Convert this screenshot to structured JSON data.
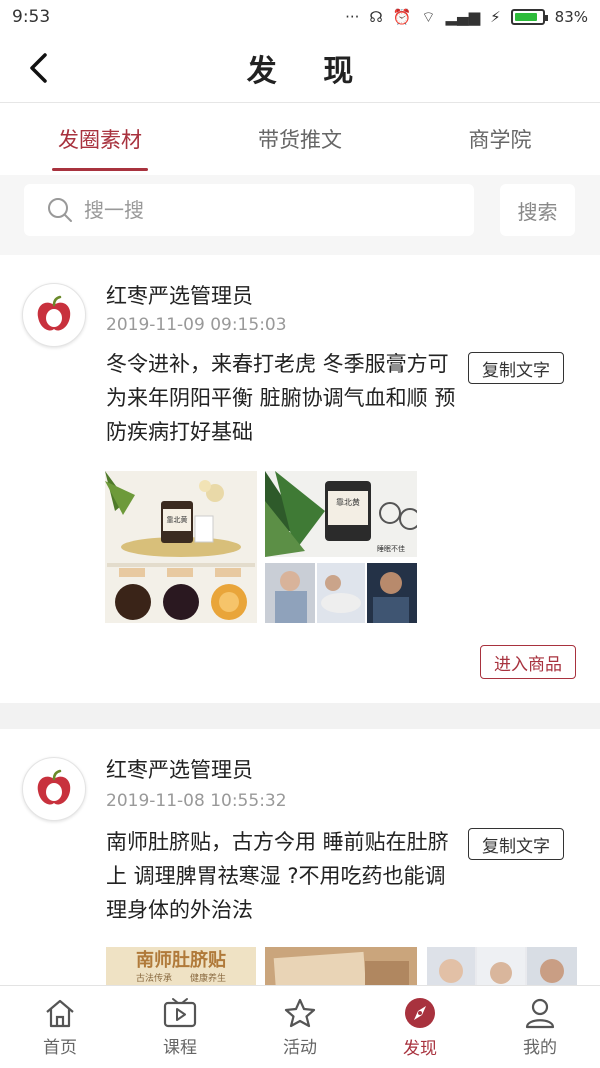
{
  "status": {
    "time": "9:53",
    "battery": "83%",
    "battery_level": 0.83
  },
  "header": {
    "title": "发 现"
  },
  "tabs": [
    {
      "label": "发圈素材",
      "active": true
    },
    {
      "label": "带货推文",
      "active": false
    },
    {
      "label": "商学院",
      "active": false
    }
  ],
  "search": {
    "placeholder": "搜一搜",
    "button": "搜索"
  },
  "posts": [
    {
      "author": "红枣严选管理员",
      "time": "2019-11-09 09:15:03",
      "text": "冬令进补，来春打老虎 冬季服膏方可为来年阴阳平衡 脏腑协调气血和顺 预防疾病打好基础",
      "copy_label": "复制文字",
      "enter_label": "进入商品",
      "image_text": {
        "label1": "靠北黄",
        "label2": "靠北黄",
        "caption": "睡眠不佳"
      }
    },
    {
      "author": "红枣严选管理员",
      "time": "2019-11-08 10:55:32",
      "text": "南师肚脐贴，古方今用 睡前贴在肚脐上 调理脾胃祛寒湿 ?不用吃药也能调理身体的外治法",
      "copy_label": "复制文字",
      "image_text": {
        "banner": "南师肚脐贴",
        "sub1": "古法传承",
        "sub2": "健康养生"
      }
    }
  ],
  "nav": [
    {
      "label": "首页",
      "icon": "home-icon",
      "active": false
    },
    {
      "label": "课程",
      "icon": "video-icon",
      "active": false
    },
    {
      "label": "活动",
      "icon": "star-icon",
      "active": false
    },
    {
      "label": "发现",
      "icon": "compass-icon",
      "active": true
    },
    {
      "label": "我的",
      "icon": "person-icon",
      "active": false
    }
  ],
  "colors": {
    "accent": "#a8323e",
    "apple": "#c8313d"
  }
}
